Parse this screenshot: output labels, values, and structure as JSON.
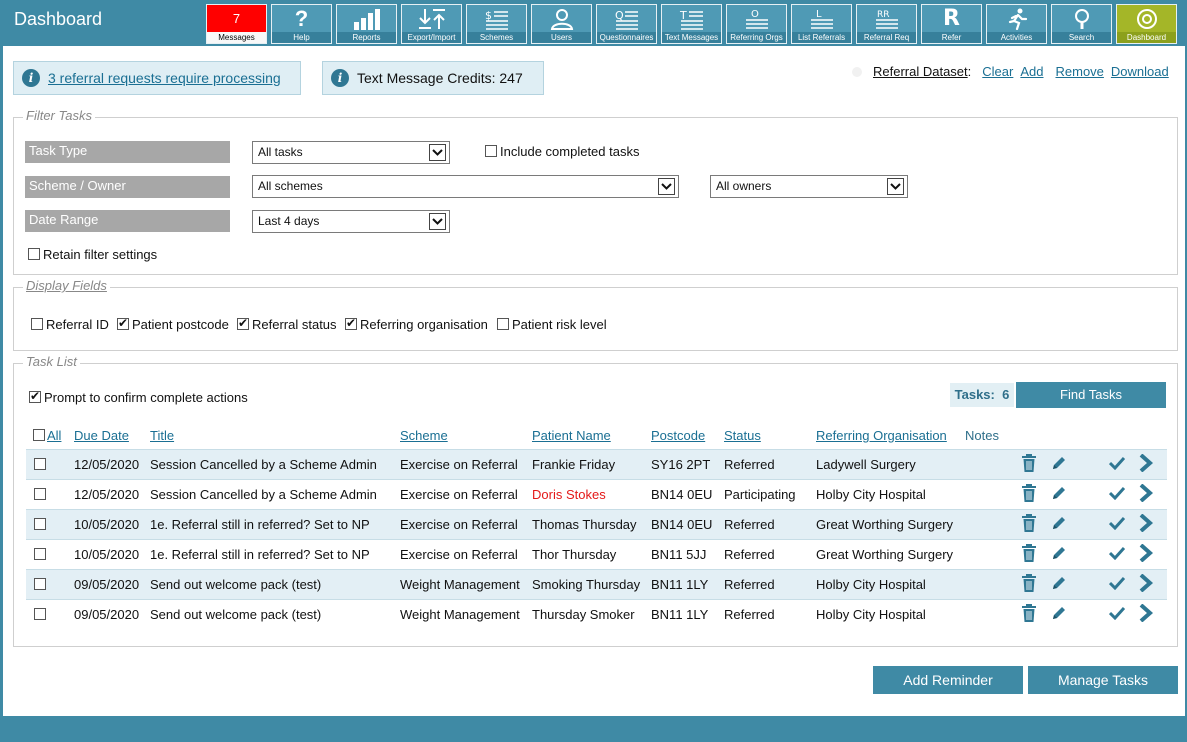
{
  "app": {
    "title": "Dashboard"
  },
  "toolbar": [
    {
      "label": "Messages",
      "icon": "messages-count",
      "count": "7"
    },
    {
      "label": "Help",
      "icon": "help-icon"
    },
    {
      "label": "Reports",
      "icon": "bar-chart-icon"
    },
    {
      "label": "Export/Import",
      "icon": "export-import-icon"
    },
    {
      "label": "Schemes",
      "icon": "schemes-icon"
    },
    {
      "label": "Users",
      "icon": "user-icon"
    },
    {
      "label": "Questionnaires",
      "icon": "questionnaire-icon"
    },
    {
      "label": "Text Messages",
      "icon": "text-message-icon"
    },
    {
      "label": "Referring Orgs",
      "icon": "referring-orgs-icon"
    },
    {
      "label": "List Referrals",
      "icon": "list-referrals-icon"
    },
    {
      "label": "Referral Req",
      "icon": "referral-request-icon"
    },
    {
      "label": "Refer",
      "icon": "refer-icon"
    },
    {
      "label": "Activities",
      "icon": "running-person-icon"
    },
    {
      "label": "Search",
      "icon": "search-icon"
    },
    {
      "label": "Dashboard",
      "icon": "dashboard-icon"
    }
  ],
  "notices": {
    "referral_requests": "3 referral requests require processing",
    "sms_credits": "Text Message Credits: 247"
  },
  "dataset": {
    "label": "Referral Dataset",
    "separator": ":",
    "clear": "Clear",
    "add": "Add",
    "remove": "Remove",
    "download": "Download"
  },
  "filter": {
    "legend": "Filter Tasks",
    "task_type_label": "Task Type",
    "task_type_value": "All tasks",
    "include_completed": "Include completed tasks",
    "scheme_owner_label": "Scheme / Owner",
    "scheme_value": "All schemes",
    "owner_value": "All owners",
    "date_range_label": "Date Range",
    "date_range_value": "Last 4 days",
    "retain": "Retain filter settings"
  },
  "display_fields": {
    "legend": "Display Fields",
    "referral_id": "Referral ID",
    "patient_postcode": "Patient postcode",
    "referral_status": "Referral status",
    "referring_organisation": "Referring organisation",
    "patient_risk_level": "Patient risk level"
  },
  "task_list": {
    "legend": "Task List",
    "prompt_confirm": "Prompt to confirm complete actions",
    "tasks_label": "Tasks:",
    "tasks_count": "6",
    "find_tasks": "Find Tasks",
    "columns": {
      "all": "All",
      "due_date": "Due Date",
      "title": "Title",
      "scheme": "Scheme",
      "patient_name": "Patient Name",
      "postcode": "Postcode",
      "status": "Status",
      "referring_organisation": "Referring Organisation",
      "notes": "Notes"
    },
    "rows": [
      {
        "due": "12/05/2020",
        "title": "Session Cancelled by a Scheme Admin",
        "scheme": "Exercise on Referral",
        "patient": "Frankie Friday",
        "postcode": "SY16 2PT",
        "status": "Referred",
        "org": "Ladywell Surgery"
      },
      {
        "due": "12/05/2020",
        "title": "Session Cancelled by a Scheme Admin",
        "scheme": "Exercise on Referral",
        "patient": "Doris Stokes",
        "postcode": "BN14 0EU",
        "status": "Participating",
        "org": "Holby City Hospital"
      },
      {
        "due": "10/05/2020",
        "title": "1e. Referral still in referred? Set to NP",
        "scheme": "Exercise on Referral",
        "patient": "Thomas Thursday",
        "postcode": "BN14 0EU",
        "status": "Referred",
        "org": "Great Worthing Surgery"
      },
      {
        "due": "10/05/2020",
        "title": "1e. Referral still in referred? Set to NP",
        "scheme": "Exercise on Referral",
        "patient": "Thor Thursday",
        "postcode": "BN11 5JJ",
        "status": "Referred",
        "org": "Great Worthing Surgery"
      },
      {
        "due": "09/05/2020",
        "title": "Send out welcome pack (test)",
        "scheme": "Weight Management",
        "patient": "Smoking Thursday",
        "postcode": "BN11 1LY",
        "status": "Referred",
        "org": "Holby City Hospital"
      },
      {
        "due": "09/05/2020",
        "title": "Send out welcome pack (test)",
        "scheme": "Weight Management",
        "patient": "Thursday Smoker",
        "postcode": "BN11 1LY",
        "status": "Referred",
        "org": "Holby City Hospital"
      }
    ]
  },
  "footer_buttons": {
    "add_reminder": "Add Reminder",
    "manage_tasks": "Manage Tasks"
  },
  "colors": {
    "brand": "#3f8aa5",
    "alert": "#ff0000",
    "active": "#a4b628",
    "patient_highlight": "#e41818"
  }
}
